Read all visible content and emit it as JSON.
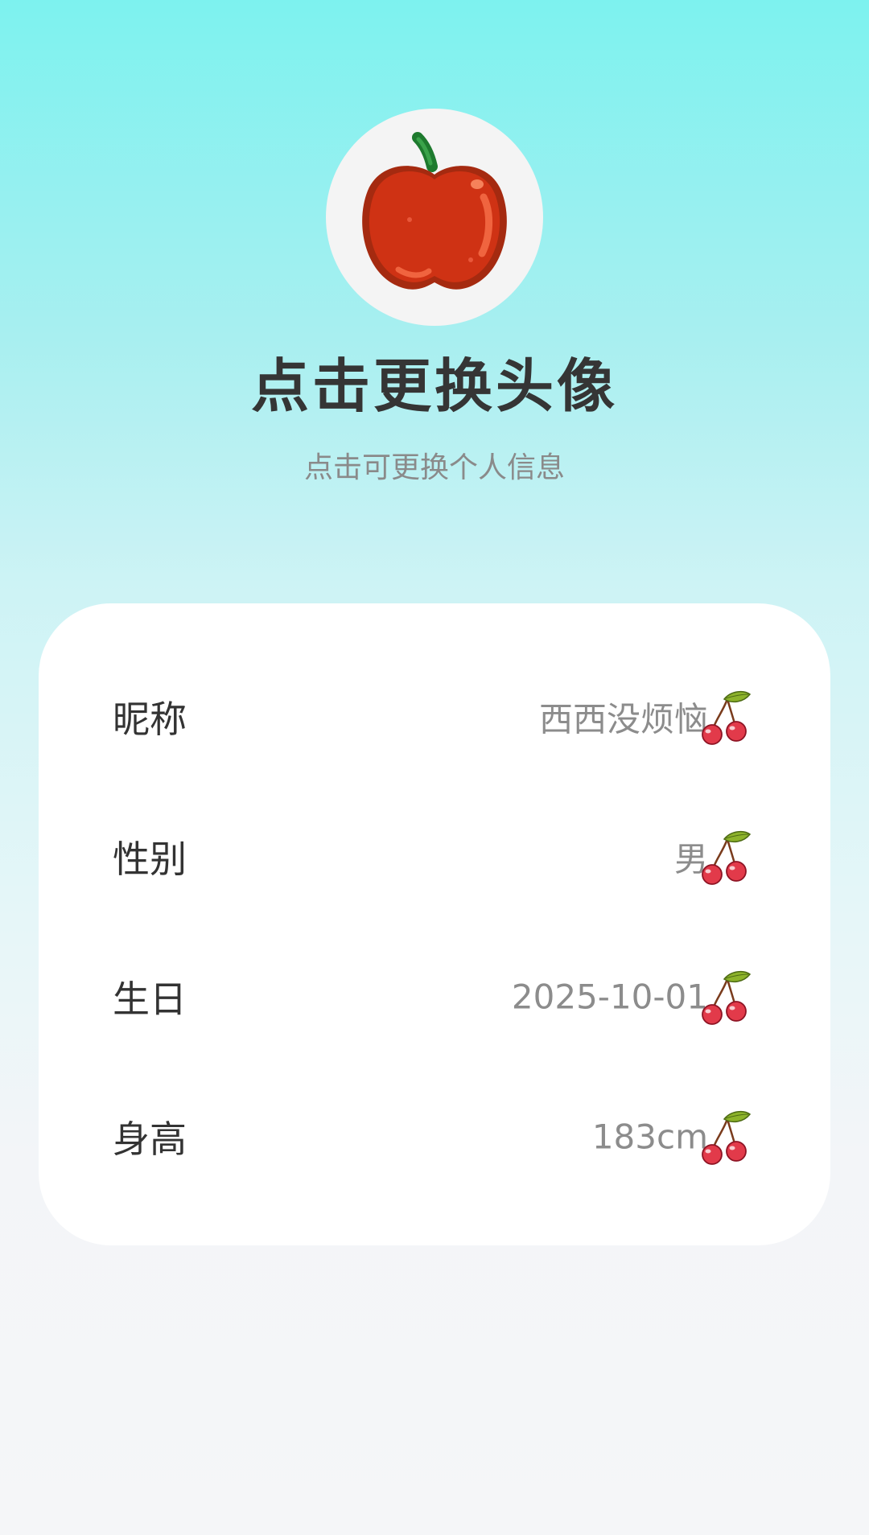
{
  "profile": {
    "avatar_icon": "apple-icon",
    "title": "点击更换头像",
    "subtitle": "点击可更换个人信息"
  },
  "fields": [
    {
      "label": "昵称",
      "value": "西西没烦恼",
      "icon": "cherry-icon"
    },
    {
      "label": "性别",
      "value": "男",
      "icon": "cherry-icon"
    },
    {
      "label": "生日",
      "value": "2025-10-01",
      "icon": "cherry-icon"
    },
    {
      "label": "身高",
      "value": "183cm",
      "icon": "cherry-icon"
    }
  ],
  "colors": {
    "gradient_top": "#7df2ef",
    "background_bottom": "#f5f6f8",
    "card": "#ffffff",
    "title_text": "#353535",
    "label_text": "#333333",
    "value_text": "#8c8c8c",
    "apple_red": "#cf3214",
    "cherry_red": "#e23a4a"
  }
}
